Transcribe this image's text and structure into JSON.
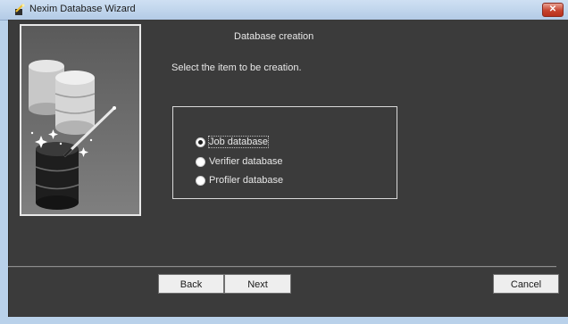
{
  "window": {
    "title": "Nexim Database Wizard",
    "close_label": "✕"
  },
  "wizard": {
    "heading": "Database creation",
    "instruction": "Select the item to be creation.",
    "options": [
      {
        "label": "Job database",
        "selected": true
      },
      {
        "label": "Verifier database",
        "selected": false
      },
      {
        "label": "Profiler database",
        "selected": false
      }
    ]
  },
  "buttons": {
    "back": "Back",
    "next": "Next",
    "cancel": "Cancel"
  },
  "icons": {
    "app": "wizard-app-icon",
    "illustration": "database-wizard-illustration"
  }
}
